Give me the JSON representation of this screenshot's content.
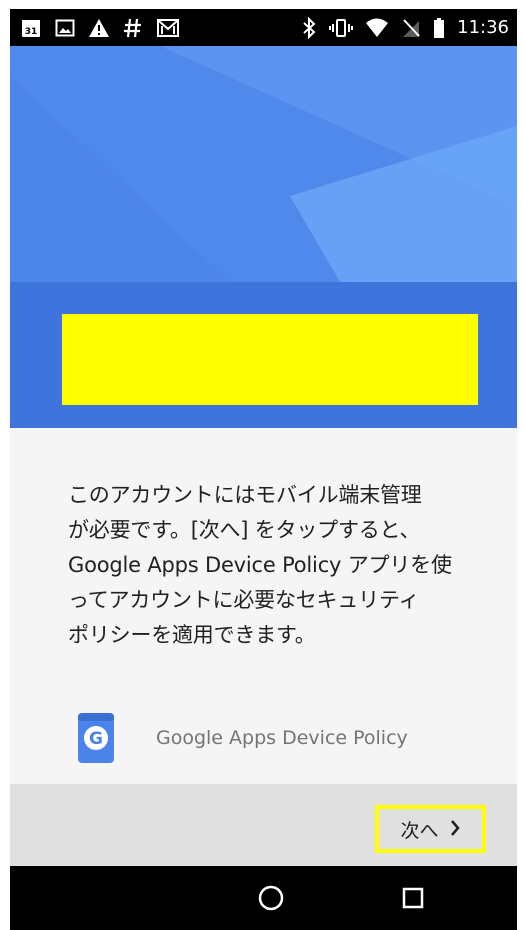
{
  "status_bar": {
    "time": "11:36",
    "left_icons": [
      "calendar-icon",
      "image-icon",
      "alert-icon",
      "hash-icon",
      "gmail-icon"
    ],
    "right_icons": [
      "bluetooth-icon",
      "vibrate-icon",
      "wifi-icon",
      "no-sim-icon",
      "battery-icon"
    ],
    "calendar_day": "31"
  },
  "message": "このアカウントにはモバイル端末管理\nが必要です。[次へ] をタップすると、\nGoogle Apps Device Policy アプリを使\nってアカウントに必要なセキュリティ\nポリシーを適用できます。",
  "app": {
    "name": "Google Apps Device Policy",
    "icon_letter": "G"
  },
  "actions": {
    "next_label": "次へ",
    "next_chevron": "›"
  },
  "navigation": {
    "buttons": [
      "home-icon",
      "recents-icon"
    ]
  },
  "colors": {
    "header_top": "#5a94f0",
    "header_bottom": "#3f74dc",
    "highlight": "#ffff00",
    "content_bg": "#f5f5f5",
    "action_bar": "#e0e0e0"
  }
}
